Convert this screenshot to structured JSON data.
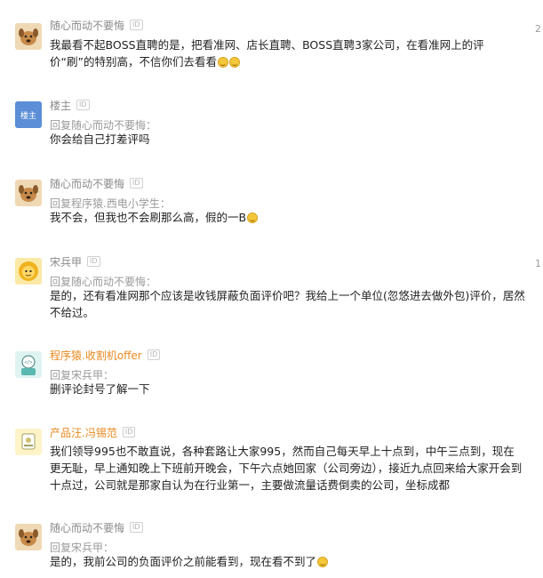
{
  "comments": [
    {
      "user": "随心而动不要悔",
      "id_badge": "ID",
      "text": "我最看不起BOSS直聘的是，把看准网、店长直聘、BOSS直聘3家公司，在看准网上的评价“刷”的特别高，不信你们去看看",
      "emojis": [
        "grin-emoji",
        "grin-emoji"
      ],
      "side_number": "2"
    },
    {
      "user": "楼主",
      "id_badge": "ID",
      "avatar_text": "楼主",
      "reply_to": "回复随心而动不要悔：",
      "text": "你会给自己打差评吗"
    },
    {
      "user": "随心而动不要悔",
      "id_badge": "ID",
      "reply_to": "回复程序猿.西电小学生：",
      "text": "我不会，但我也不会刷那么高，假的一B",
      "emojis": [
        "laugh-cry-emoji"
      ]
    },
    {
      "user": "宋兵甲",
      "id_badge": "ID",
      "reply_to": "回复随心而动不要悔：",
      "text": "是的，还有看准网那个应该是收钱屏蔽负面评价吧？我给上一个单位(忽悠进去做外包)评价，居然不给过。",
      "side_number": "1"
    },
    {
      "user": "程序猿.收割机offer",
      "id_badge": "ID",
      "reply_to": "回复宋兵甲：",
      "text": "删评论封号了解一下"
    },
    {
      "user": "产品汪.冯锡范",
      "id_badge": "ID",
      "text": "我们领导995也不敢直说，各种套路让大家995，然而自己每天早上十点到，中午三点到，现在更无耻，早上通知晚上下班前开晚会，下午六点她回家（公司旁边），接近九点回来给大家开会到十点过，公司就是那家自认为在行业第一，主要做流量话费倒卖的公司，坐标成都"
    },
    {
      "user": "随心而动不要悔",
      "id_badge": "ID",
      "reply_to": "回复宋兵甲：",
      "text": "是的，我前公司的负面评价之前能看到，现在看不到了",
      "emojis": [
        "grin-emoji"
      ]
    }
  ],
  "colors": {
    "name_gray": "#8a8a8a",
    "name_orange": "#e8891f",
    "avatar_blue": "#5b8ed6"
  }
}
